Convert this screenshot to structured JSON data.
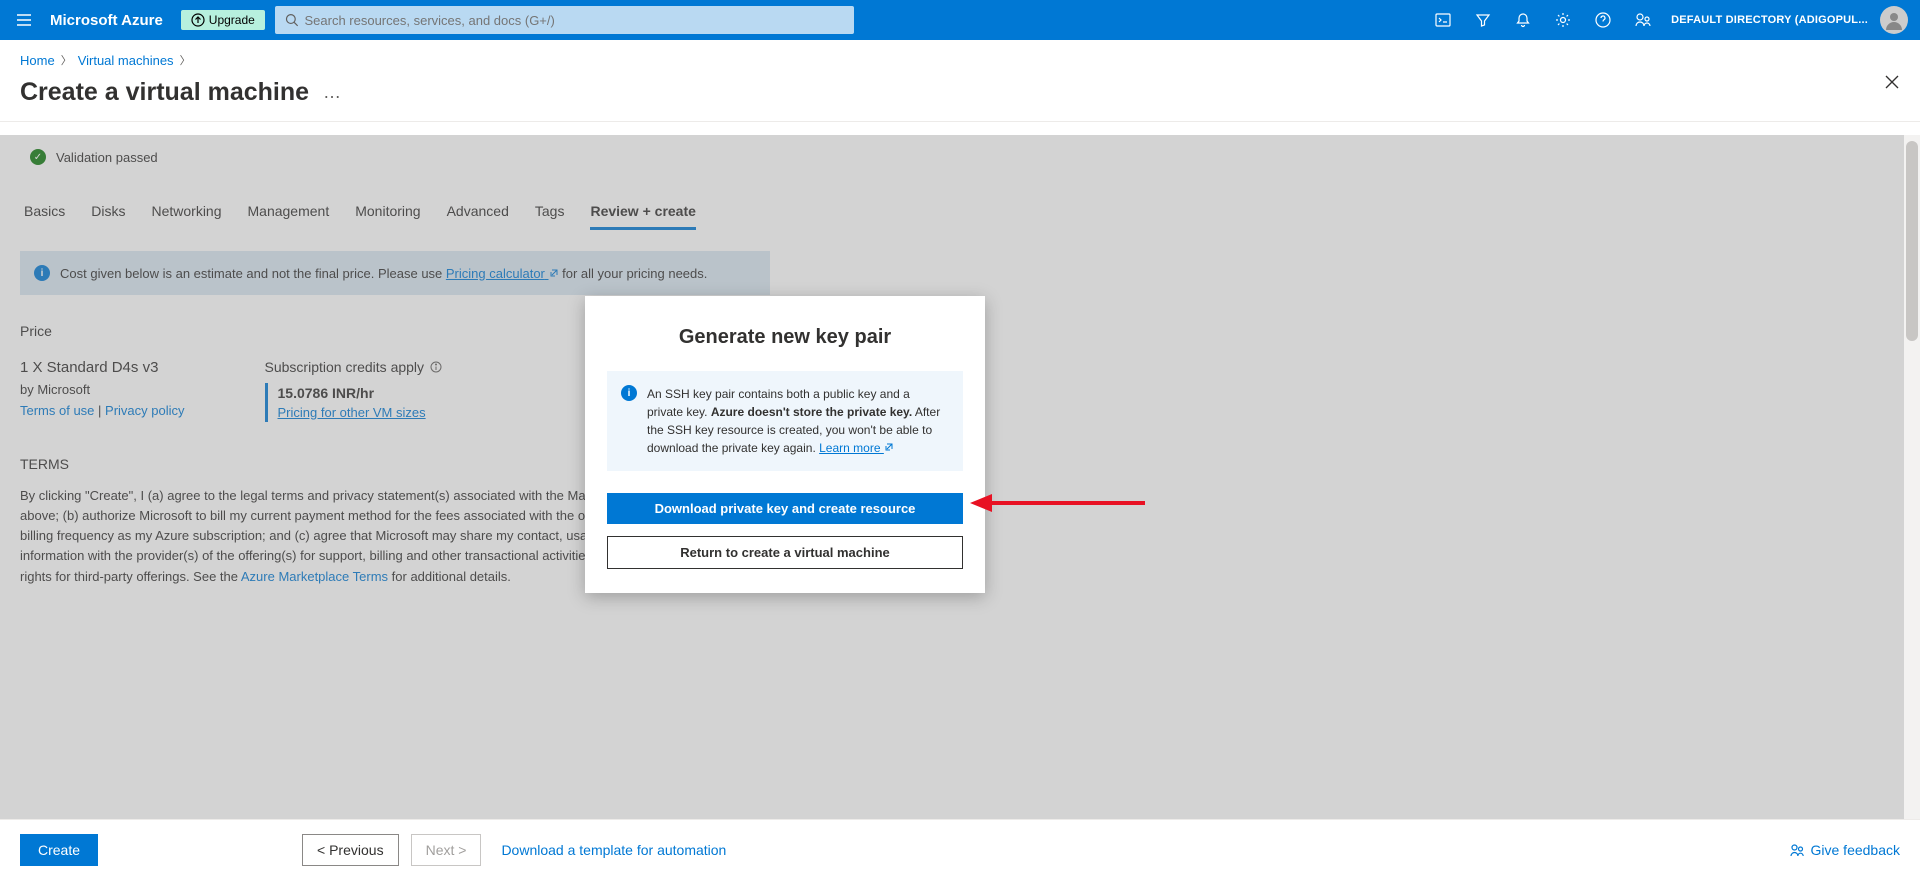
{
  "header": {
    "brand": "Microsoft Azure",
    "upgrade_label": "Upgrade",
    "search_placeholder": "Search resources, services, and docs (G+/)",
    "directory_label": "DEFAULT DIRECTORY (ADIGOPUL..."
  },
  "breadcrumb": {
    "home": "Home",
    "vm": "Virtual machines"
  },
  "page_title": "Create a virtual machine",
  "validation_passed": "Validation passed",
  "tabs": [
    "Basics",
    "Disks",
    "Networking",
    "Management",
    "Monitoring",
    "Advanced",
    "Tags",
    "Review + create"
  ],
  "active_tab_index": 7,
  "cost_note": {
    "pre": "Cost given below is an estimate and not the final price. Please use ",
    "link": "Pricing calculator",
    "post": " for all your pricing needs."
  },
  "price": {
    "section": "Price",
    "sku": "1 X Standard D4s v3",
    "by": "by Microsoft",
    "terms_of_use": "Terms of use",
    "privacy": "Privacy policy",
    "credits": "Subscription credits apply",
    "rate": "15.0786 INR/hr",
    "other": "Pricing for other VM sizes"
  },
  "terms": {
    "title": "TERMS",
    "body_1": "By clicking \"Create\", I (a) agree to the legal terms and privacy statement(s) associated with the Marketplace offering(s) listed above; (b) authorize Microsoft to bill my current payment method for the fees associated with the offering(s), with the same billing frequency as my Azure subscription; and (c) agree that Microsoft may share my contact, usage and transactional information with the provider(s) of the offering(s) for support, billing and other transactional activities. Microsoft does not provide rights for third-party offerings. See the ",
    "marketplace_link": "Azure Marketplace Terms",
    "body_2": " for additional details."
  },
  "footer": {
    "create": "Create",
    "previous": "< Previous",
    "next": "Next >",
    "template_link": "Download a template for automation",
    "feedback": "Give feedback"
  },
  "modal": {
    "title": "Generate new key pair",
    "info_1": "An SSH key pair contains both a public key and a private key. ",
    "info_bold": "Azure doesn't store the private key.",
    "info_2": " After the SSH key resource is created, you won't be able to download the private key again. ",
    "learn_more": "Learn more",
    "download_btn": "Download private key and create resource",
    "return_btn": "Return to create a virtual machine"
  }
}
